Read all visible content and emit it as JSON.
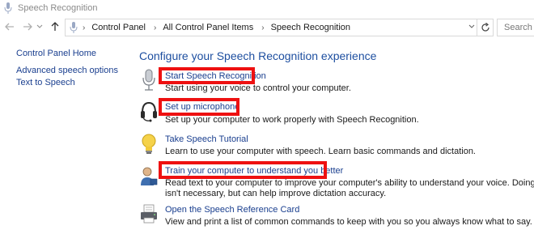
{
  "window": {
    "title": "Speech Recognition"
  },
  "address": {
    "crumbs": [
      "Control Panel",
      "All Control Panel Items",
      "Speech Recognition"
    ],
    "search_placeholder": "Search Co"
  },
  "sidebar": {
    "items": [
      {
        "label": "Control Panel Home"
      },
      {
        "label": "Advanced speech options"
      },
      {
        "label": "Text to Speech"
      }
    ]
  },
  "main": {
    "heading": "Configure your Speech Recognition experience",
    "tasks": [
      {
        "label": "Start Speech Recognition",
        "desc": "Start using your voice to control your computer.",
        "icon": "microphone-icon",
        "highlighted": true
      },
      {
        "label": "Set up microphone",
        "desc": "Set up your computer to work properly with Speech Recognition.",
        "icon": "headset-icon",
        "highlighted": true
      },
      {
        "label": "Take Speech Tutorial",
        "desc": "Learn to use your computer with speech. Learn basic commands and dictation.",
        "icon": "lightbulb-icon",
        "highlighted": false
      },
      {
        "label": "Train your computer to understand you better",
        "desc": "Read text to your computer to improve your computer's ability to understand your voice. Doing this",
        "desc2": "isn't necessary, but can help improve dictation accuracy.",
        "icon": "user-training-icon",
        "highlighted": true
      },
      {
        "label": "Open the Speech Reference Card",
        "desc": "View and print a list of common commands to keep with you so you always know what to say.",
        "icon": "printer-icon",
        "highlighted": false
      }
    ]
  },
  "colors": {
    "link": "#1a3f8f",
    "heading": "#1e4fa0",
    "highlight": "#ee1111"
  }
}
